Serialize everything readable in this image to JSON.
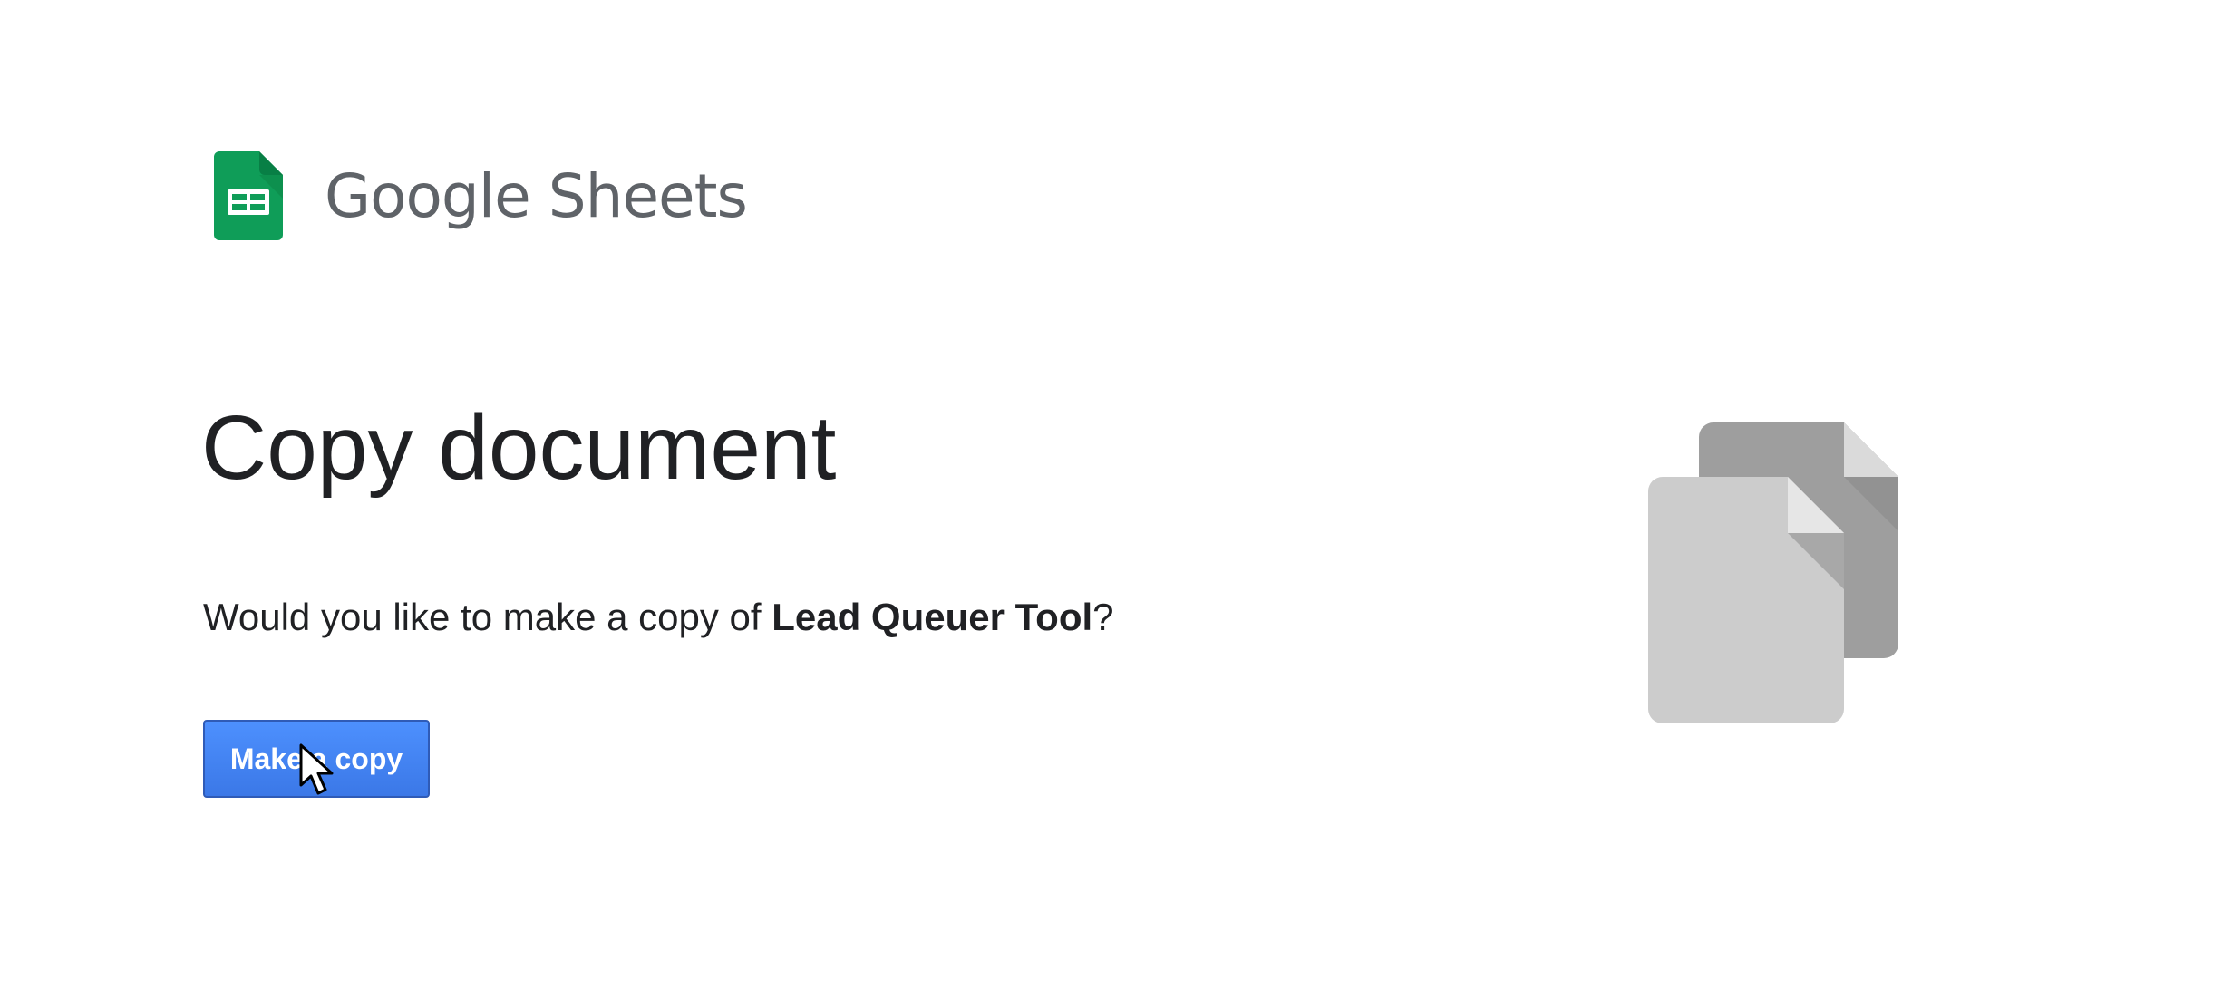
{
  "brand": {
    "product_name": "Google Sheets",
    "logo_icon": "google-sheets-logo-icon",
    "logo_color": "#0f9d58"
  },
  "page": {
    "title": "Copy document",
    "prompt_prefix": "Would you like to make a copy of ",
    "document_name": "Lead Queuer Tool",
    "prompt_suffix": "?",
    "make_copy_label": "Make a copy"
  },
  "illustration": {
    "icon": "copy-documents-icon"
  },
  "colors": {
    "button_blue": "#4285f4",
    "text": "#202124",
    "brand_text": "#5f6368"
  }
}
